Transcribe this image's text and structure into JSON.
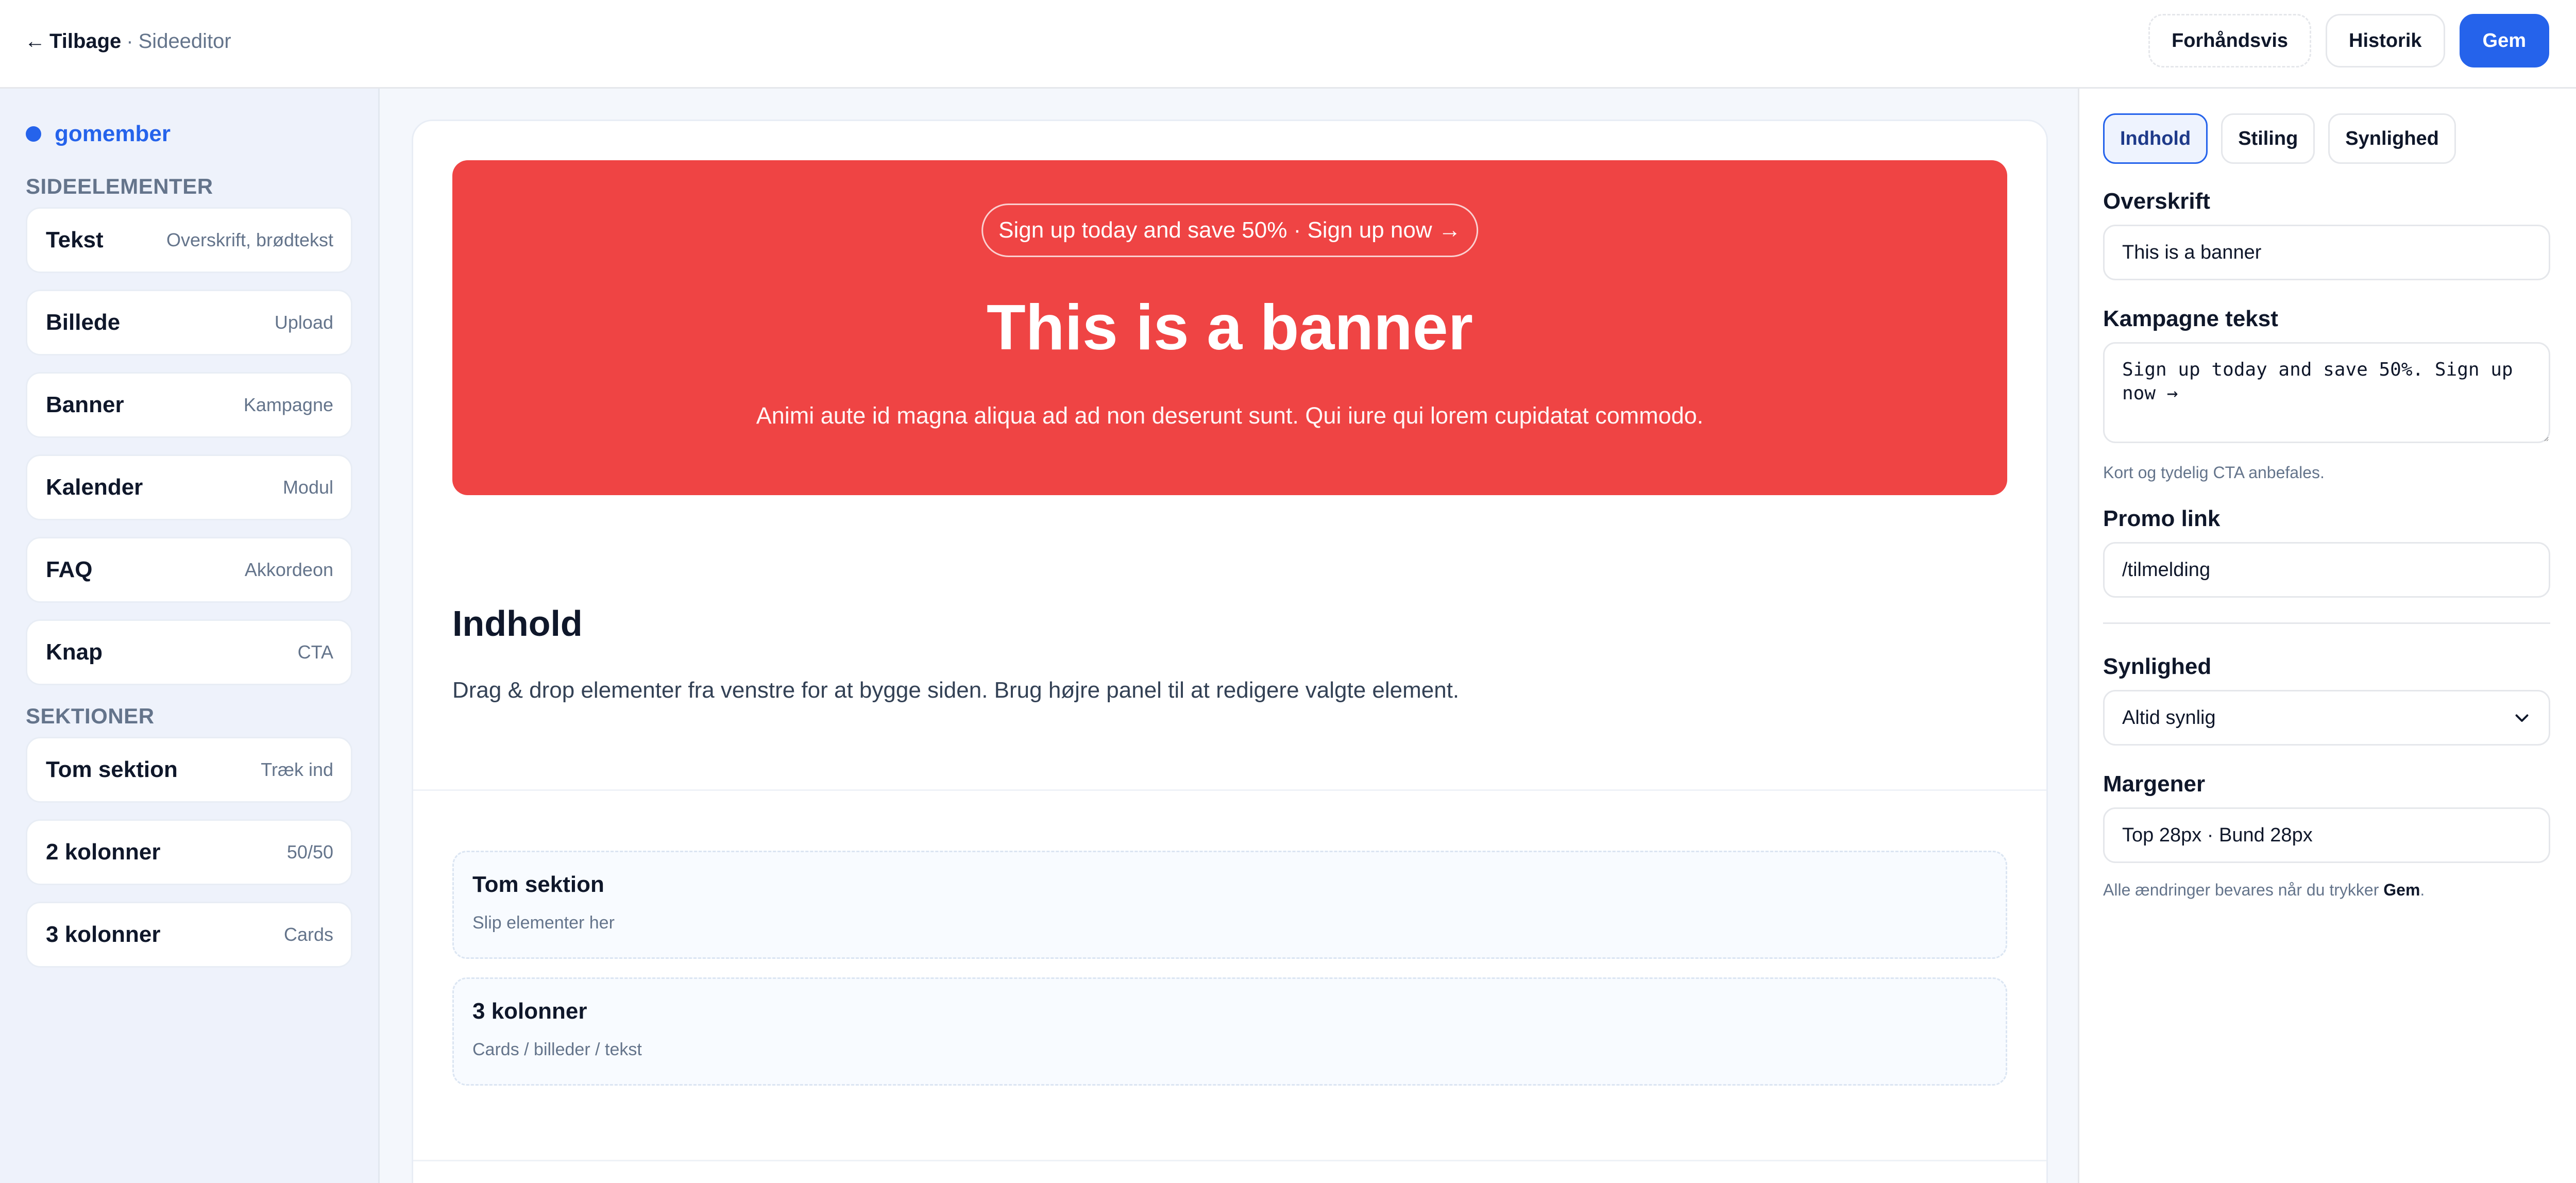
{
  "topbar": {
    "back_arrow": "←",
    "back_label": "Tilbage",
    "separator": "·",
    "subtitle": "Sideeditor",
    "actions": {
      "preview": "Forhåndsvis",
      "history": "Historik",
      "save": "Gem"
    },
    "accent_color": "#2563eb"
  },
  "sidebar": {
    "brand": "gomember",
    "elements_title": "SIDEELEMENTER",
    "elements": [
      {
        "name": "Tekst",
        "meta": "Overskrift, brødtekst"
      },
      {
        "name": "Billede",
        "meta": "Upload"
      },
      {
        "name": "Banner",
        "meta": "Kampagne"
      },
      {
        "name": "Kalender",
        "meta": "Modul"
      },
      {
        "name": "FAQ",
        "meta": "Akkordeon"
      },
      {
        "name": "Knap",
        "meta": "CTA"
      }
    ],
    "sections_title": "SEKTIONER",
    "sections": [
      {
        "name": "Tom sektion",
        "meta": "Træk ind"
      },
      {
        "name": "2 kolonner",
        "meta": "50/50"
      },
      {
        "name": "3 kolonner",
        "meta": "Cards"
      }
    ]
  },
  "canvas": {
    "banner": {
      "pill": "Sign up today and save 50% · Sign up now →",
      "title": "This is a banner",
      "text": "Animi aute id magna aliqua ad ad non deserunt sunt. Qui iure qui lorem cupidatat commodo.",
      "color": "#ef4444"
    },
    "content": {
      "title": "Indhold",
      "text": "Drag & drop elementer fra venstre for at bygge siden. Brug højre panel til at redigere valgte element."
    },
    "sections": [
      {
        "title": "Tom sektion",
        "subtitle": "Slip elementer her"
      },
      {
        "title": "3 kolonner",
        "subtitle": "Cards / billeder / tekst"
      }
    ]
  },
  "panel": {
    "tabs": [
      "Indhold",
      "Stiling",
      "Synlighed"
    ],
    "active_tab": "Indhold",
    "headline_label": "Overskrift",
    "headline_value": "This is a banner",
    "campaign_label": "Kampagne tekst",
    "campaign_value": "Sign up today and save 50%. Sign up now →",
    "campaign_hint": "Kort og tydelig CTA anbefales.",
    "promo_label": "Promo link",
    "promo_value": "/tilmelding",
    "visibility_label": "Synlighed",
    "visibility_value": "Altid synlig",
    "visibility_options": [
      "Altid synlig"
    ],
    "margins_label": "Margener",
    "margins_value": "Top 28px · Bund 28px",
    "footer_hint_prefix": "Alle ændringer bevares når du trykker",
    "footer_hint_strong": "Gem",
    "footer_hint_suffix": "."
  }
}
